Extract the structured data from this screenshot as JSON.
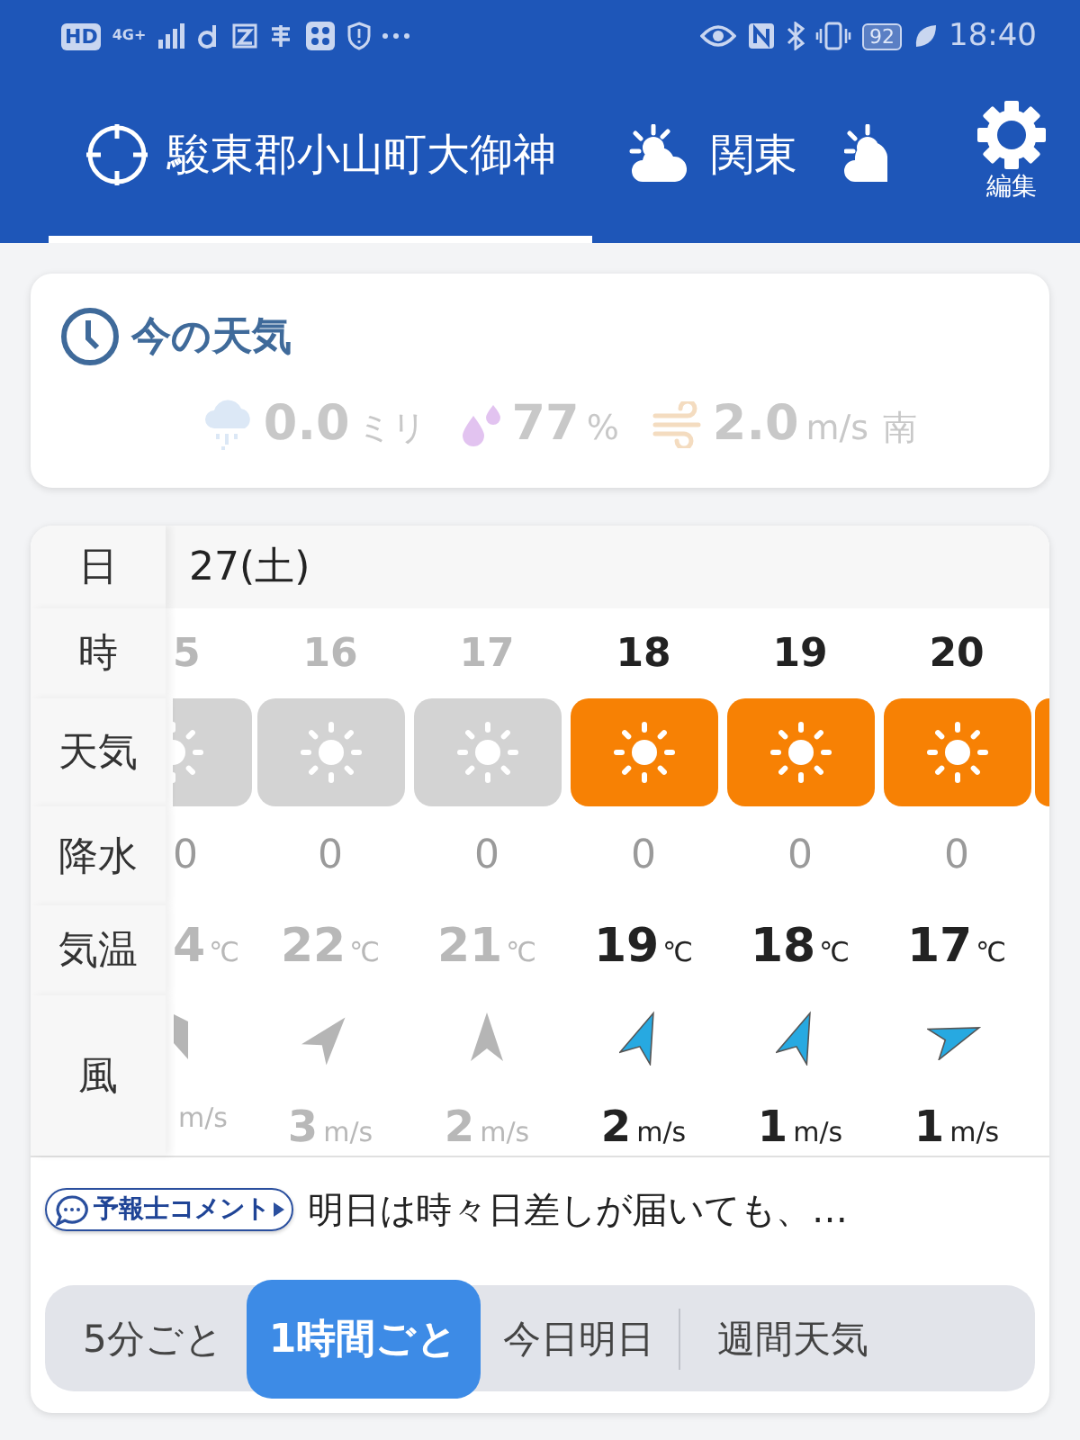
{
  "status_bar": {
    "hd": "HD",
    "network": "4G+",
    "battery": "92",
    "time": "18:40"
  },
  "location_tabs": [
    {
      "kind": "location",
      "label": "駿東郡小山町大御神",
      "selected": true
    },
    {
      "kind": "region",
      "label": "関東",
      "selected": false
    },
    {
      "kind": "partial",
      "selected": false
    }
  ],
  "edit_button": {
    "label": "編集"
  },
  "now": {
    "title": "今の天気",
    "rain": "0.0",
    "rain_unit": "ミリ",
    "humidity": "77",
    "humidity_unit": "%",
    "wind": "2.0",
    "wind_unit": "m/s",
    "wind_dir": "南"
  },
  "hourly": {
    "labels": {
      "date": "日",
      "hour": "時",
      "weather": "天気",
      "precip": "降水",
      "temp": "気温",
      "wind": "風"
    },
    "date": "27(土)",
    "columns": [
      {
        "cut_left": true,
        "hour": "5",
        "weather": {
          "kind": "sunny"
        },
        "past": true,
        "precip": "0",
        "temp": "4",
        "temp_unit": "℃",
        "wind_arrow": {
          "kind": "nne"
        },
        "speed_unit": "m/s"
      },
      {
        "hour": "16",
        "weather": {
          "kind": "sunny"
        },
        "past": true,
        "precip": "0",
        "temp": "22",
        "temp_unit": "℃",
        "wind_arrow": {
          "kind": "ne"
        },
        "speed": "3",
        "speed_unit": "m/s"
      },
      {
        "hour": "17",
        "weather": {
          "kind": "sunny"
        },
        "past": true,
        "precip": "0",
        "temp": "21",
        "temp_unit": "℃",
        "wind_arrow": {
          "kind": "n"
        },
        "speed": "2",
        "speed_unit": "m/s"
      },
      {
        "hour": "18",
        "weather": {
          "kind": "sunny"
        },
        "past": false,
        "precip": "0",
        "temp": "19",
        "temp_unit": "℃",
        "wind_arrow": {
          "kind": "nne"
        },
        "speed": "2",
        "speed_unit": "m/s"
      },
      {
        "hour": "19",
        "weather": {
          "kind": "sunny"
        },
        "past": false,
        "precip": "0",
        "temp": "18",
        "temp_unit": "℃",
        "wind_arrow": {
          "kind": "nne"
        },
        "speed": "1",
        "speed_unit": "m/s"
      },
      {
        "hour": "20",
        "weather": {
          "kind": "sunny"
        },
        "past": false,
        "precip": "0",
        "temp": "17",
        "temp_unit": "℃",
        "wind_arrow": {
          "kind": "ene"
        },
        "speed": "1",
        "speed_unit": "m/s"
      },
      {
        "cut_right": true,
        "weather": {
          "kind": "sunny"
        },
        "past": false
      }
    ]
  },
  "comment": {
    "badge": "予報士コメント",
    "text": "明日は時々日差しが届いても、…"
  },
  "modes": [
    {
      "label": "5分ごと",
      "selected": false
    },
    {
      "label": "1時間ごと",
      "selected": true
    },
    {
      "label": "今日明日",
      "selected": false
    },
    {
      "label": "週間天気",
      "selected": false
    }
  ]
}
